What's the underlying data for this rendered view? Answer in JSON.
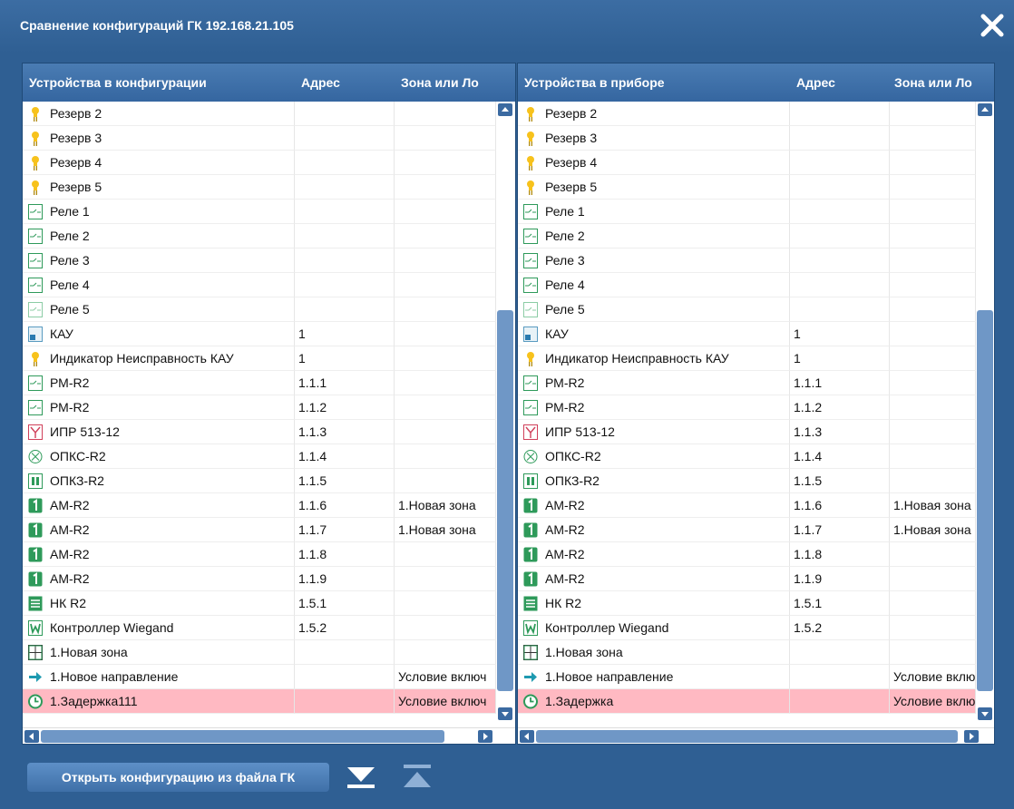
{
  "title": "Сравнение конфигураций ГК 192.168.21.105",
  "left": {
    "columns": [
      "Устройства в конфигурации",
      "Адрес",
      "Зона или Ло"
    ],
    "rows": [
      {
        "icon": "bulb-icon",
        "name": "Резерв 2",
        "addr": "",
        "zone": ""
      },
      {
        "icon": "bulb-icon",
        "name": "Резерв 3",
        "addr": "",
        "zone": ""
      },
      {
        "icon": "bulb-icon",
        "name": "Резерв 4",
        "addr": "",
        "zone": ""
      },
      {
        "icon": "bulb-icon",
        "name": "Резерв 5",
        "addr": "",
        "zone": ""
      },
      {
        "icon": "relay-icon",
        "name": "Реле 1",
        "addr": "",
        "zone": ""
      },
      {
        "icon": "relay-icon",
        "name": "Реле 2",
        "addr": "",
        "zone": ""
      },
      {
        "icon": "relay-icon",
        "name": "Реле 3",
        "addr": "",
        "zone": ""
      },
      {
        "icon": "relay-icon",
        "name": "Реле 4",
        "addr": "",
        "zone": ""
      },
      {
        "icon": "relay-faded-icon",
        "name": "Реле 5",
        "addr": "",
        "zone": ""
      },
      {
        "icon": "kau-icon",
        "name": "КАУ",
        "addr": "1",
        "zone": ""
      },
      {
        "icon": "bulb-icon",
        "name": "Индикатор Неисправность КАУ",
        "addr": "1",
        "zone": ""
      },
      {
        "icon": "relay-icon",
        "name": "РМ-R2",
        "addr": "1.1.1",
        "zone": ""
      },
      {
        "icon": "relay-icon",
        "name": "РМ-R2",
        "addr": "1.1.2",
        "zone": ""
      },
      {
        "icon": "ipr-icon",
        "name": "ИПР 513-12",
        "addr": "1.1.3",
        "zone": ""
      },
      {
        "icon": "opks-icon",
        "name": "ОПКС-R2",
        "addr": "1.1.4",
        "zone": ""
      },
      {
        "icon": "opkz-icon",
        "name": "ОПКЗ-R2",
        "addr": "1.1.5",
        "zone": ""
      },
      {
        "icon": "am-icon",
        "name": "АМ-R2",
        "addr": "1.1.6",
        "zone": "1.Новая зона"
      },
      {
        "icon": "am-icon",
        "name": "АМ-R2",
        "addr": "1.1.7",
        "zone": "1.Новая зона"
      },
      {
        "icon": "am-icon",
        "name": "АМ-R2",
        "addr": "1.1.8",
        "zone": ""
      },
      {
        "icon": "am-icon",
        "name": "АМ-R2",
        "addr": "1.1.9",
        "zone": ""
      },
      {
        "icon": "nk-icon",
        "name": "НК R2",
        "addr": "1.5.1",
        "zone": ""
      },
      {
        "icon": "wiegand-icon",
        "name": "Контроллер Wiegand",
        "addr": "1.5.2",
        "zone": ""
      },
      {
        "icon": "zone-icon",
        "name": "1.Новая зона",
        "addr": "",
        "zone": ""
      },
      {
        "icon": "direction-icon",
        "name": "1.Новое направление",
        "addr": "",
        "zone": "Условие включ"
      },
      {
        "icon": "clock-icon",
        "name": "1.Задержка111",
        "addr": "",
        "zone": "Условие включ",
        "highlight": true
      }
    ]
  },
  "right": {
    "columns": [
      "Устройства в приборе",
      "Адрес",
      "Зона или Ло"
    ],
    "rows": [
      {
        "icon": "bulb-icon",
        "name": "Резерв 2",
        "addr": "",
        "zone": ""
      },
      {
        "icon": "bulb-icon",
        "name": "Резерв 3",
        "addr": "",
        "zone": ""
      },
      {
        "icon": "bulb-icon",
        "name": "Резерв 4",
        "addr": "",
        "zone": ""
      },
      {
        "icon": "bulb-icon",
        "name": "Резерв 5",
        "addr": "",
        "zone": ""
      },
      {
        "icon": "relay-icon",
        "name": "Реле 1",
        "addr": "",
        "zone": ""
      },
      {
        "icon": "relay-icon",
        "name": "Реле 2",
        "addr": "",
        "zone": ""
      },
      {
        "icon": "relay-icon",
        "name": "Реле 3",
        "addr": "",
        "zone": ""
      },
      {
        "icon": "relay-icon",
        "name": "Реле 4",
        "addr": "",
        "zone": ""
      },
      {
        "icon": "relay-faded-icon",
        "name": "Реле 5",
        "addr": "",
        "zone": ""
      },
      {
        "icon": "kau-icon",
        "name": "КАУ",
        "addr": "1",
        "zone": ""
      },
      {
        "icon": "bulb-icon",
        "name": "Индикатор Неисправность КАУ",
        "addr": "1",
        "zone": ""
      },
      {
        "icon": "relay-icon",
        "name": "РМ-R2",
        "addr": "1.1.1",
        "zone": ""
      },
      {
        "icon": "relay-icon",
        "name": "РМ-R2",
        "addr": "1.1.2",
        "zone": ""
      },
      {
        "icon": "ipr-icon",
        "name": "ИПР 513-12",
        "addr": "1.1.3",
        "zone": ""
      },
      {
        "icon": "opks-icon",
        "name": "ОПКС-R2",
        "addr": "1.1.4",
        "zone": ""
      },
      {
        "icon": "opkz-icon",
        "name": "ОПКЗ-R2",
        "addr": "1.1.5",
        "zone": ""
      },
      {
        "icon": "am-icon",
        "name": "АМ-R2",
        "addr": "1.1.6",
        "zone": "1.Новая зона"
      },
      {
        "icon": "am-icon",
        "name": "АМ-R2",
        "addr": "1.1.7",
        "zone": "1.Новая зона"
      },
      {
        "icon": "am-icon",
        "name": "АМ-R2",
        "addr": "1.1.8",
        "zone": ""
      },
      {
        "icon": "am-icon",
        "name": "АМ-R2",
        "addr": "1.1.9",
        "zone": ""
      },
      {
        "icon": "nk-icon",
        "name": "НК R2",
        "addr": "1.5.1",
        "zone": ""
      },
      {
        "icon": "wiegand-icon",
        "name": "Контроллер Wiegand",
        "addr": "1.5.2",
        "zone": ""
      },
      {
        "icon": "zone-icon",
        "name": "1.Новая зона",
        "addr": "",
        "zone": ""
      },
      {
        "icon": "direction-icon",
        "name": "1.Новое направление",
        "addr": "",
        "zone": "Условие включ"
      },
      {
        "icon": "clock-icon",
        "name": "1.Задержка",
        "addr": "",
        "zone": "Условие включ",
        "highlight": true
      }
    ]
  },
  "footer": {
    "open_label": "Открыть конфигурацию из файла ГК"
  },
  "colors": {
    "dialog_bg": "#2f5f93",
    "header_bg": "#3d6ea6",
    "highlight_row": "#ffb9c2",
    "scroll_thumb": "#6f97c6"
  }
}
